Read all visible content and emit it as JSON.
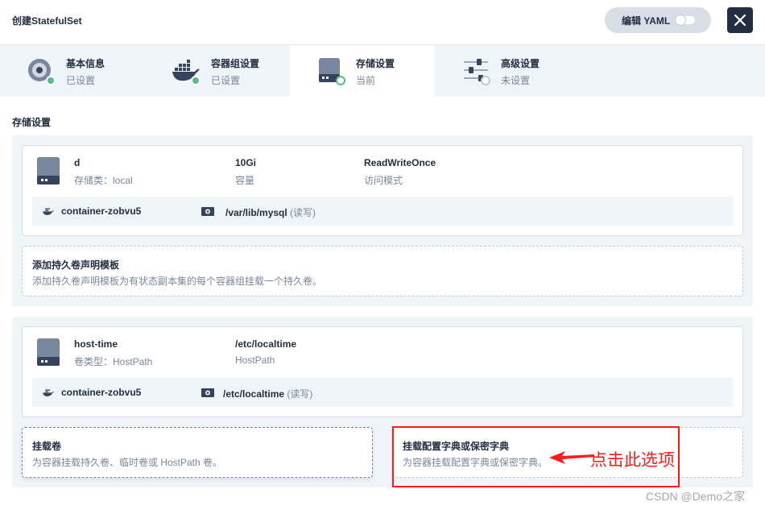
{
  "header": {
    "title": "创建StatefulSet",
    "yaml_label": "编辑 YAML"
  },
  "tabs": [
    {
      "title": "基本信息",
      "status": "已设置",
      "icon": "disc-icon"
    },
    {
      "title": "容器组设置",
      "status": "已设置",
      "icon": "docker-whale-icon"
    },
    {
      "title": "存储设置",
      "status": "当前",
      "icon": "hard-drive-icon"
    },
    {
      "title": "高级设置",
      "status": "未设置",
      "icon": "sliders-icon"
    }
  ],
  "section_title": "存储设置",
  "volume_templates": {
    "card": {
      "name": "d",
      "name_sub": "存储类：local",
      "capacity": "10Gi",
      "capacity_label": "容量",
      "access_mode": "ReadWriteOnce",
      "access_label": "访问模式",
      "mount": {
        "container": "container-zobvu5",
        "path": "/var/lib/mysql",
        "mode": "(读写)"
      }
    },
    "add": {
      "title": "添加持久卷声明模板",
      "desc": "添加持久卷声明模板为有状态副本集的每个容器组挂载一个持久卷。"
    }
  },
  "volumes": {
    "card": {
      "name": "host-time",
      "name_sub": "卷类型：HostPath",
      "path": "/etc/localtime",
      "path_sub": "HostPath",
      "mount": {
        "container": "container-zobvu5",
        "path": "/etc/localtime",
        "mode": "(读写)"
      }
    },
    "mount_volume": {
      "title": "挂载卷",
      "desc": "为容器挂载持久卷、临时卷或 HostPath 卷。"
    },
    "mount_config": {
      "title": "挂载配置字典或保密字典",
      "desc": "为容器挂载配置字典或保密字典。"
    }
  },
  "annotation": {
    "text": "点击此选项",
    "color": "#ff1a1a"
  },
  "watermark": "CSDN @Demo之家",
  "colors": {
    "dark": "#242e42",
    "muted": "#79879c",
    "tab_bg": "#eff4f9",
    "success": "#55bc8a"
  }
}
